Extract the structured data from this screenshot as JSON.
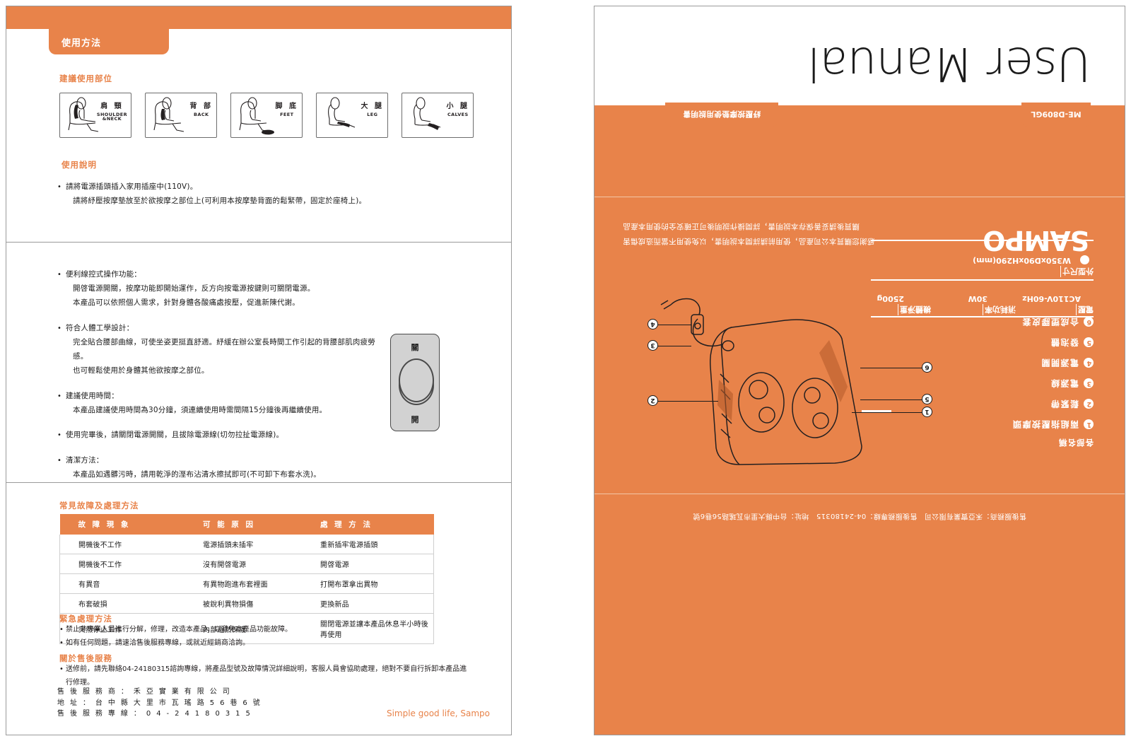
{
  "left_page": {
    "tab_label": "使用方法",
    "section1": {
      "heading": "建議使用部位",
      "parts": [
        {
          "zh": "肩 頸",
          "en": "SHOULDER",
          "en2": "&NECK",
          "icon": "chair-shoulder-icon"
        },
        {
          "zh": "背 部",
          "en": "BACK",
          "en2": "",
          "icon": "chair-back-icon"
        },
        {
          "zh": "脚 底",
          "en": "FEET",
          "en2": "",
          "icon": "chair-feet-icon"
        },
        {
          "zh": "大 腿",
          "en": "LEG",
          "en2": "",
          "icon": "chair-leg-icon"
        },
        {
          "zh": "小 腿",
          "en": "CALVES",
          "en2": "",
          "icon": "chair-calves-icon"
        }
      ],
      "usage_heading": "使用說明",
      "usage_line1": "請將電源插頭插入家用插座中(110V)。",
      "usage_line2": "請將紓壓按摩墊放至於欲按摩之部位上(可利用本按摩墊背面的鬆緊帶，固定於座椅上)。"
    },
    "section2": {
      "items": [
        {
          "title": "便利線控式操作功能：",
          "lines": [
            "開啓電源開關，按摩功能即開始運作，反方向按電源按鍵則可關閉電源。",
            "本產品可以依照個人需求，針對身體各酸痛處按壓，促進新陳代謝。"
          ]
        },
        {
          "title": "符合人體工學設計：",
          "lines": [
            "完全貼合腰部曲線，可使坐姿更挺直舒適。紓緩在辦公室長時間工作引起的背腰部肌肉疲勞感。",
            "也可輕鬆使用於身體其他欲按摩之部位。"
          ]
        },
        {
          "title": "建議使用時間：",
          "lines": [
            "本產品建議使用時間為30分鐘，須連續使用時需間隔15分鐘後再繼續使用。"
          ]
        },
        {
          "title": "使用完畢後，請關閉電源開關，且拔除電源線(切勿拉扯電源線)。",
          "lines": []
        },
        {
          "title": "清潔方法：",
          "lines": [
            "本產品如遇髒污時，請用乾淨的溼布沾清水擦拭即可(不可卸下布套水洗)。"
          ]
        }
      ],
      "controller": {
        "top_label": "關",
        "bottom_label": "開",
        "name": "hand-controller-illustration"
      }
    },
    "section3": {
      "table_heading": "常見故障及處理方法",
      "columns": [
        "故 障 現 象",
        "可 能 原 因",
        "處 理 方 法"
      ],
      "rows": [
        [
          "開機後不工作",
          "電源插頭未插牢",
          "重新插牢電源插頭"
        ],
        [
          "開機後不工作",
          "沒有開啓電源",
          "開啓電源"
        ],
        [
          "有異音",
          "有異物跑進布套裡面",
          "打開布罩拿出異物"
        ],
        [
          "布套破損",
          "被銳利異物損傷",
          "更換新品"
        ],
        [
          "突然停止工作",
          "內部過熱保護",
          "關閉電源並讓本產品休息半小時後再使用"
        ]
      ],
      "emergency_heading": "緊急處理方法",
      "emergency_lines": [
        "禁止非專業人員進行分解，修理，改造本產品，以避免本產品功能故障。",
        "如有任何問題，請速洽售後服務專線，或就近經銷商洽詢。"
      ],
      "service_heading": "關於售後服務",
      "service_lines": [
        "送修前，請先聯絡04-24180315諮詢專線，將產品型號及故障情況詳細說明，客服人員會協助處理，絕對不要自行拆卸本產品進行修理。"
      ],
      "footer": [
        "售 後 服 務 商 ： 禾 亞 實 業 有 限 公 司",
        "地 址 ： 台 中 縣 大 里 市 瓦 瑤 路 5 6 巷 6 號",
        "售 後 服 務 專 線 ： 0 4 - 2 4 1 8 0 3 1 5"
      ],
      "slogan": "Simple good life, Sampo"
    }
  },
  "right_page": {
    "title": "User Manual",
    "model_tab": "ME-D809GL",
    "category_tab": "紓壓按摩墊使用說明書",
    "brand": "SAMPO",
    "top_note_lines": [
      "感謝您購買本公司產品，使用前請詳閱本說明書，以免使用不當而造成傷害",
      "購買後請妥善保存本說明書，詳閱操作說明後可正確安全的使用本產品"
    ],
    "spec_labels": [
      "電壓",
      "消耗功率",
      "機體淨重"
    ],
    "spec_values": [
      "AC110V-60Hz",
      "30W",
      "2500g"
    ],
    "dimension_label": "外型尺寸",
    "dimension_value": "W350xD90xH290(mm)",
    "parts_title": "各部名稱",
    "parts": [
      {
        "num": "1",
        "label": "兩組指壓按摩頭"
      },
      {
        "num": "2",
        "label": "鬆緊帶"
      },
      {
        "num": "3",
        "label": "電源線"
      },
      {
        "num": "4",
        "label": "電源開關"
      },
      {
        "num": "5",
        "label": "發泡體"
      },
      {
        "num": "6",
        "label": "合成塑膠皮套"
      }
    ],
    "footer_note": "售後服務商：禾亞實業有限公司　售後服務專線：04-24180315　地址：台中縣大里市瓦瑤路56巷6號",
    "diagram_name": "massage-cushion-diagram"
  },
  "colors": {
    "orange": "#e8834a",
    "text": "#231f20",
    "border": "#9a9a9a"
  }
}
